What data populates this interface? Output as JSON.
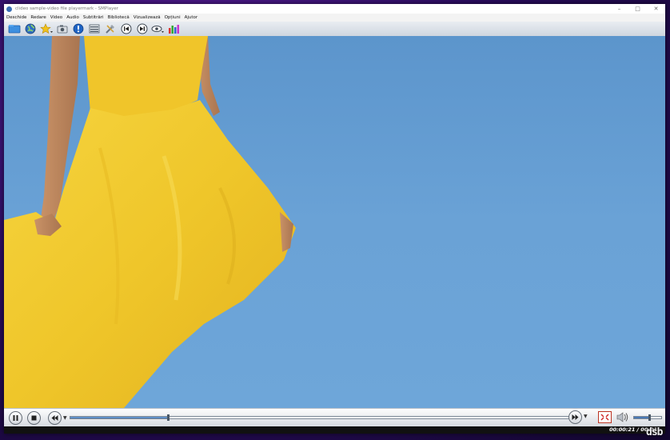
{
  "window": {
    "title": "clideo sample-video file playermark - SMPlayer",
    "controls": {
      "minimize": "–",
      "maximize": "□",
      "close": "✕"
    }
  },
  "menu": {
    "items": [
      "Deschide",
      "Redare",
      "Video",
      "Audio",
      "Subtitrări",
      "Bibliotecă",
      "Vizualizează",
      "Opțiuni",
      "Ajutor"
    ]
  },
  "toolbar": {
    "icons": [
      "open-file-icon",
      "globe-icon",
      "favorites-star-icon",
      "screenshot-camera-icon",
      "info-icon",
      "playlist-icon",
      "tools-icon",
      "previous-icon",
      "next-icon",
      "eye-view-icon",
      "equalizer-icon"
    ]
  },
  "controls": {
    "seek_progress": 0.195,
    "volume_level": 0.55
  },
  "status": {
    "time": "00:00:21 / 00:01"
  },
  "watermark": "dsb",
  "colors": {
    "sky": "#6aa2d6",
    "dress": "#f2cb2f",
    "accent": "#3e72b1"
  }
}
